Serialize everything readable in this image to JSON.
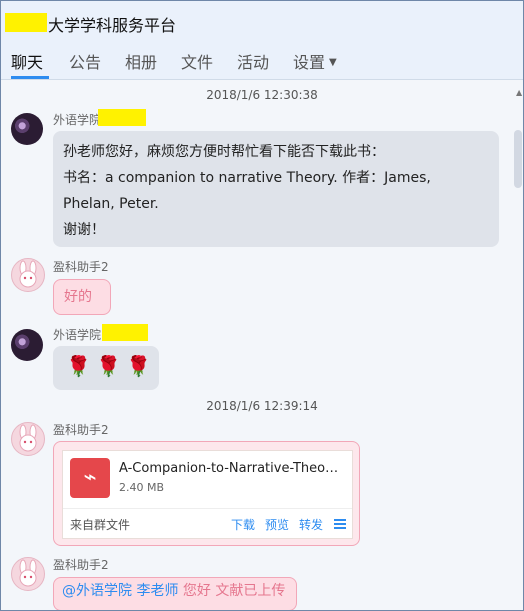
{
  "window": {
    "title": "大学学科服务平台"
  },
  "tabs": [
    {
      "label": "聊天",
      "active": true
    },
    {
      "label": "公告"
    },
    {
      "label": "相册"
    },
    {
      "label": "文件"
    },
    {
      "label": "活动"
    },
    {
      "label": "设置"
    }
  ],
  "chat": {
    "timestamps": [
      "2018/1/6 12:30:38",
      "2018/1/6 12:39:14"
    ],
    "messages": [
      {
        "sender": "外语学院",
        "avatar": "flower-avatar",
        "lines": [
          "孙老师您好，麻烦您方便时帮忙看下能否下载此书：",
          "书名：a companion to narrative Theory. 作者：James,",
          "Phelan, Peter.",
          "谢谢！"
        ]
      },
      {
        "sender": "盈科助手2",
        "avatar": "bunny-avatar",
        "text": "好的"
      },
      {
        "sender": "外语学院",
        "avatar": "flower-avatar",
        "emoji": [
          "🌹",
          "🌹",
          "🌹"
        ]
      },
      {
        "sender": "盈科助手2",
        "avatar": "bunny-avatar",
        "file": {
          "icon": "pdf-icon",
          "name": "A-Companion-to-Narrative-Theory-....",
          "size": "2.40 MB",
          "source": "来自群文件",
          "actions": [
            "下载",
            "预览",
            "转发"
          ]
        }
      },
      {
        "sender": "盈科助手2",
        "avatar": "bunny-avatar",
        "mention": "@外语学院 李老师",
        "text": "您好 文献已上传"
      }
    ]
  },
  "colors": {
    "accent": "#2d8cf0",
    "pink_bubble": "#fddde4",
    "gray_bubble": "#dfe3ea",
    "redaction": "#fff200"
  }
}
